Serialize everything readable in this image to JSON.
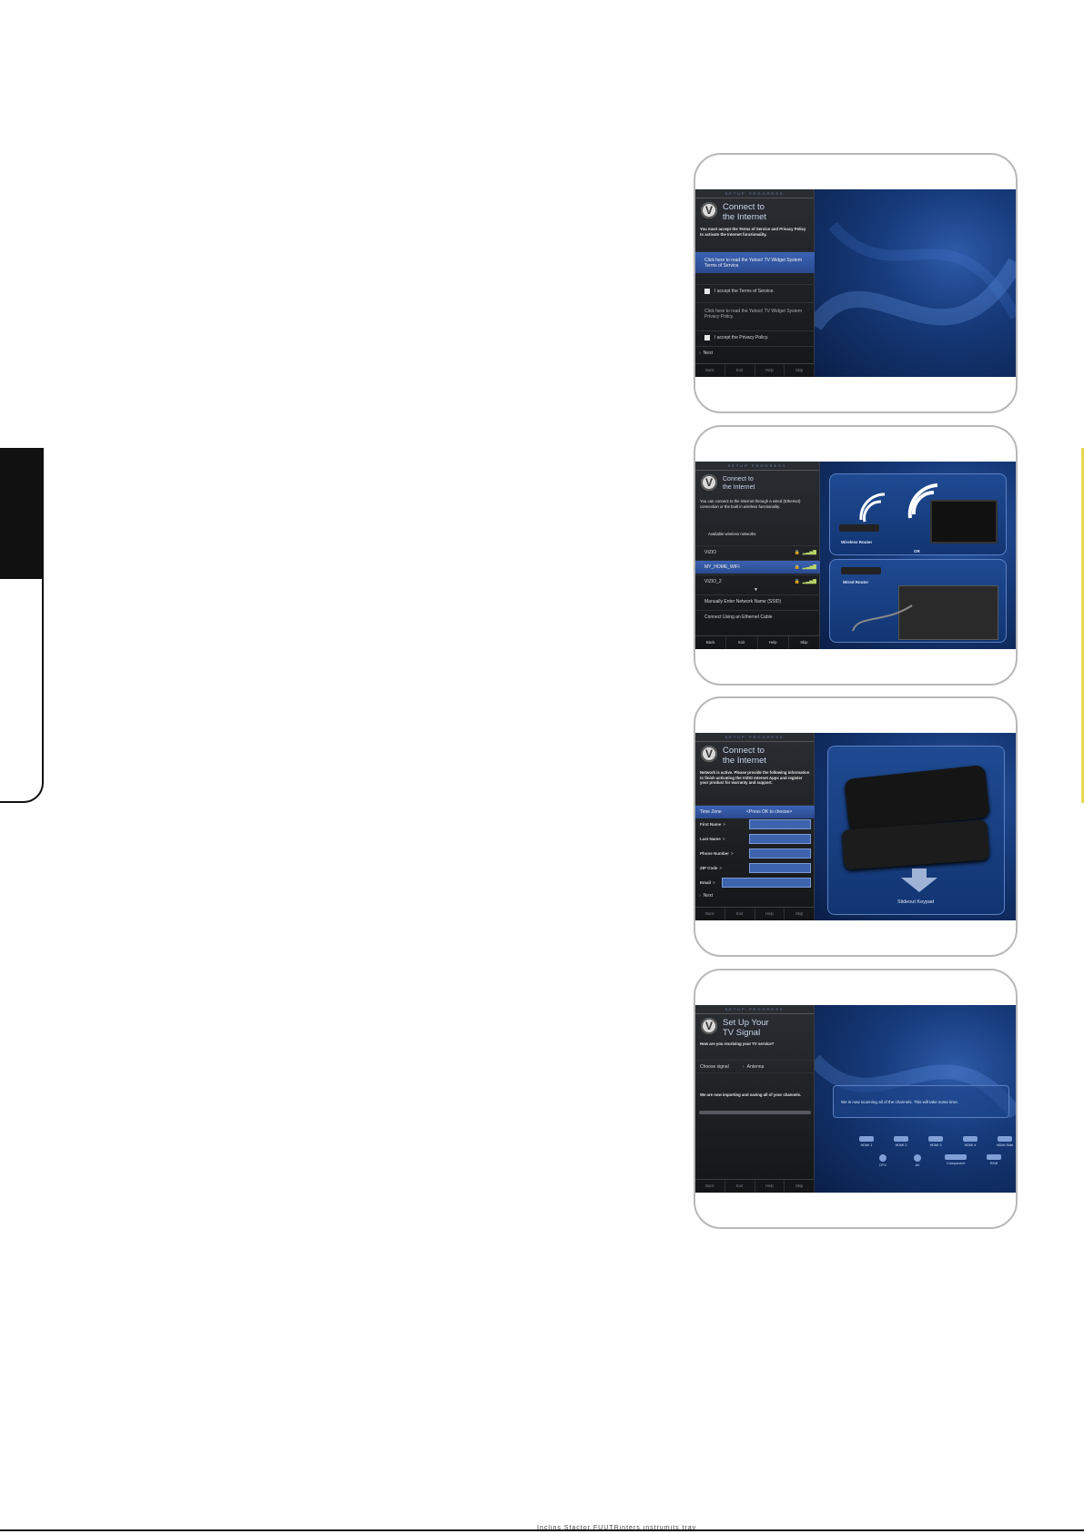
{
  "side": {},
  "footer": {
    "glyphs": "Inclins Sfactor FUUTRinters instrumits trav"
  },
  "screens": [
    {
      "progress": "SETUP PROGRESS",
      "title_line1": "Connect to",
      "title_line2": "the Internet",
      "intro": "You must accept the Terms of Service and Privacy Policy to activate the Internet functionality.",
      "rows": [
        "Click here to read the Yahoo! TV Widget System Terms of Service.",
        "I accept the Terms of Service.",
        "Click here to read the Yahoo! TV Widget System Privacy Policy.",
        "I accept the Privacy Policy.",
        "Next"
      ],
      "buttons": [
        "Back",
        "Exit",
        "Help",
        "Skip"
      ]
    },
    {
      "progress": "SETUP PROGRESS",
      "title_line1": "Connect to",
      "title_line2": "the Internet",
      "intro": "You can connect to the Internet through a wired (Ethernet) connection or the built in wireless functionality.",
      "networks_label": "Available wireless networks",
      "networks": [
        "VIZIO",
        "MY_HOME_WIFI",
        "VIZIO_2"
      ],
      "options": [
        "Manually Enter Network Name (SSID)",
        "Connect Using an Ethernet Cable"
      ],
      "buttons": [
        "Back",
        "Exit",
        "Help",
        "Skip"
      ],
      "wireless_router_label": "Wireless Router",
      "wired_router_label": "Wired Router",
      "or_label": "OR"
    },
    {
      "progress": "SETUP PROGRESS",
      "title_line1": "Connect to",
      "title_line2": "the Internet",
      "intro": "Network is active. Please provide the following information to finish activating the VIZIO Internet Apps and register your product for warranty and support.",
      "fields": [
        "Time Zone",
        "First Name",
        "Last Name",
        "Phone Number",
        "ZIP Code",
        "Email"
      ],
      "time_zone_value": "<Press OK to choose>",
      "next": "Next",
      "buttons": [
        "Back",
        "Exit",
        "Help",
        "Skip"
      ],
      "keypad_caption": "Slideout Keypad"
    },
    {
      "progress": "SETUP PROGRESS",
      "title_line1": "Set Up Your",
      "title_line2": "TV Signal",
      "question": "How are you receiving your TV service?",
      "choose_label": "Choose signal",
      "choose_value": "Antenna",
      "status": "We are now importing and saving all of your channels.",
      "message": "We is now scanning all of the channels. This will take some time.",
      "ports_top": [
        "HDMI 1",
        "HDMI 2",
        "HDMI 3",
        "HDMI 4",
        "HDMI Side"
      ],
      "ports_bottom": [
        "DTV",
        "AV",
        "Component",
        "RGB"
      ],
      "buttons": [
        "Back",
        "Exit",
        "Help",
        "Skip"
      ]
    }
  ]
}
